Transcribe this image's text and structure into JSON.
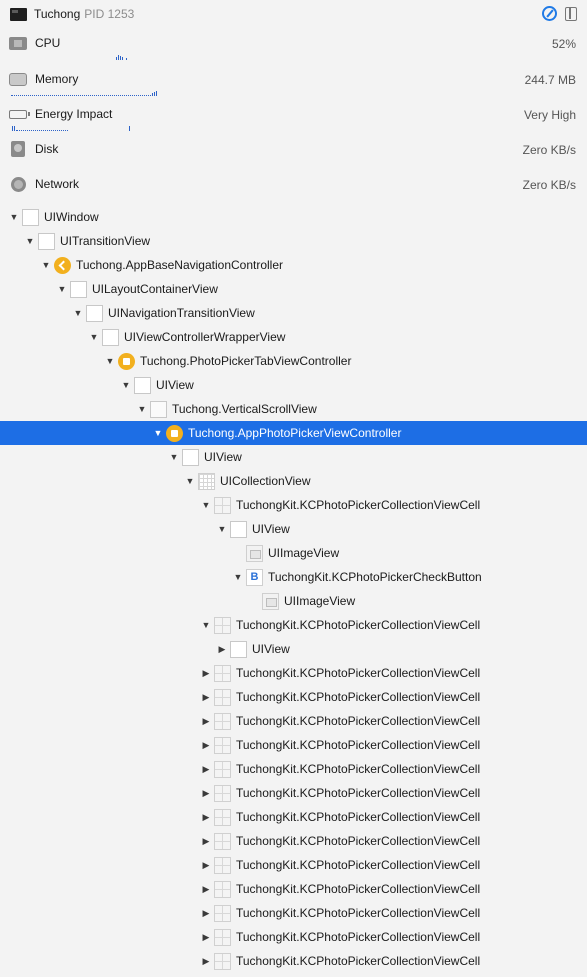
{
  "header": {
    "process_name": "Tuchong",
    "pid_label": "PID 1253",
    "icons": {
      "app": "app-window-icon",
      "debug": "compass-icon",
      "panel": "panel-layout-icon"
    }
  },
  "gauges": [
    {
      "id": "cpu",
      "label": "CPU",
      "value": "52%",
      "icon": "cpu-icon"
    },
    {
      "id": "memory",
      "label": "Memory",
      "value": "244.7 MB",
      "icon": "memory-icon"
    },
    {
      "id": "energy",
      "label": "Energy Impact",
      "value": "Very High",
      "icon": "battery-icon"
    },
    {
      "id": "disk",
      "label": "Disk",
      "value": "Zero KB/s",
      "icon": "disk-icon"
    },
    {
      "id": "network",
      "label": "Network",
      "value": "Zero KB/s",
      "icon": "network-icon"
    }
  ],
  "colors": {
    "selection": "#1d6ee5",
    "accent": "#1f7ae6",
    "controller_icon": "#f2b01e"
  },
  "tree": [
    {
      "label": "UIWindow",
      "depth": 0,
      "disclosure": "expanded",
      "icon": "view"
    },
    {
      "label": "UITransitionView",
      "depth": 1,
      "disclosure": "expanded",
      "icon": "view"
    },
    {
      "label": "Tuchong.AppBaseNavigationController",
      "depth": 2,
      "disclosure": "expanded",
      "icon": "nav"
    },
    {
      "label": "UILayoutContainerView",
      "depth": 3,
      "disclosure": "expanded",
      "icon": "view"
    },
    {
      "label": "UINavigationTransitionView",
      "depth": 4,
      "disclosure": "expanded",
      "icon": "view"
    },
    {
      "label": "UIViewControllerWrapperView",
      "depth": 5,
      "disclosure": "expanded",
      "icon": "view"
    },
    {
      "label": "Tuchong.PhotoPickerTabViewController",
      "depth": 6,
      "disclosure": "expanded",
      "icon": "ctrl"
    },
    {
      "label": "UIView",
      "depth": 7,
      "disclosure": "expanded",
      "icon": "view"
    },
    {
      "label": "Tuchong.VerticalScrollView",
      "depth": 8,
      "disclosure": "expanded",
      "icon": "scroll"
    },
    {
      "label": "Tuchong.AppPhotoPickerViewController",
      "depth": 9,
      "disclosure": "expanded",
      "icon": "ctrl",
      "selected": true
    },
    {
      "label": "UIView",
      "depth": 10,
      "disclosure": "expanded",
      "icon": "view"
    },
    {
      "label": "UICollectionView",
      "depth": 11,
      "disclosure": "expanded",
      "icon": "collection"
    },
    {
      "label": "TuchongKit.KCPhotoPickerCollectionViewCell",
      "depth": 12,
      "disclosure": "expanded",
      "icon": "cell"
    },
    {
      "label": "UIView",
      "depth": 13,
      "disclosure": "expanded",
      "icon": "view"
    },
    {
      "label": "UIImageView",
      "depth": 14,
      "disclosure": "none",
      "icon": "image"
    },
    {
      "label": "TuchongKit.KCPhotoPickerCheckButton",
      "depth": 14,
      "disclosure": "expanded",
      "icon": "button"
    },
    {
      "label": "UIImageView",
      "depth": 15,
      "disclosure": "none",
      "icon": "image"
    },
    {
      "label": "TuchongKit.KCPhotoPickerCollectionViewCell",
      "depth": 12,
      "disclosure": "expanded",
      "icon": "cell"
    },
    {
      "label": "UIView",
      "depth": 13,
      "disclosure": "collapsed",
      "icon": "view"
    },
    {
      "label": "TuchongKit.KCPhotoPickerCollectionViewCell",
      "depth": 12,
      "disclosure": "collapsed",
      "icon": "cell"
    },
    {
      "label": "TuchongKit.KCPhotoPickerCollectionViewCell",
      "depth": 12,
      "disclosure": "collapsed",
      "icon": "cell"
    },
    {
      "label": "TuchongKit.KCPhotoPickerCollectionViewCell",
      "depth": 12,
      "disclosure": "collapsed",
      "icon": "cell"
    },
    {
      "label": "TuchongKit.KCPhotoPickerCollectionViewCell",
      "depth": 12,
      "disclosure": "collapsed",
      "icon": "cell"
    },
    {
      "label": "TuchongKit.KCPhotoPickerCollectionViewCell",
      "depth": 12,
      "disclosure": "collapsed",
      "icon": "cell"
    },
    {
      "label": "TuchongKit.KCPhotoPickerCollectionViewCell",
      "depth": 12,
      "disclosure": "collapsed",
      "icon": "cell"
    },
    {
      "label": "TuchongKit.KCPhotoPickerCollectionViewCell",
      "depth": 12,
      "disclosure": "collapsed",
      "icon": "cell"
    },
    {
      "label": "TuchongKit.KCPhotoPickerCollectionViewCell",
      "depth": 12,
      "disclosure": "collapsed",
      "icon": "cell"
    },
    {
      "label": "TuchongKit.KCPhotoPickerCollectionViewCell",
      "depth": 12,
      "disclosure": "collapsed",
      "icon": "cell"
    },
    {
      "label": "TuchongKit.KCPhotoPickerCollectionViewCell",
      "depth": 12,
      "disclosure": "collapsed",
      "icon": "cell"
    },
    {
      "label": "TuchongKit.KCPhotoPickerCollectionViewCell",
      "depth": 12,
      "disclosure": "collapsed",
      "icon": "cell"
    },
    {
      "label": "TuchongKit.KCPhotoPickerCollectionViewCell",
      "depth": 12,
      "disclosure": "collapsed",
      "icon": "cell"
    },
    {
      "label": "TuchongKit.KCPhotoPickerCollectionViewCell",
      "depth": 12,
      "disclosure": "collapsed",
      "icon": "cell"
    }
  ]
}
